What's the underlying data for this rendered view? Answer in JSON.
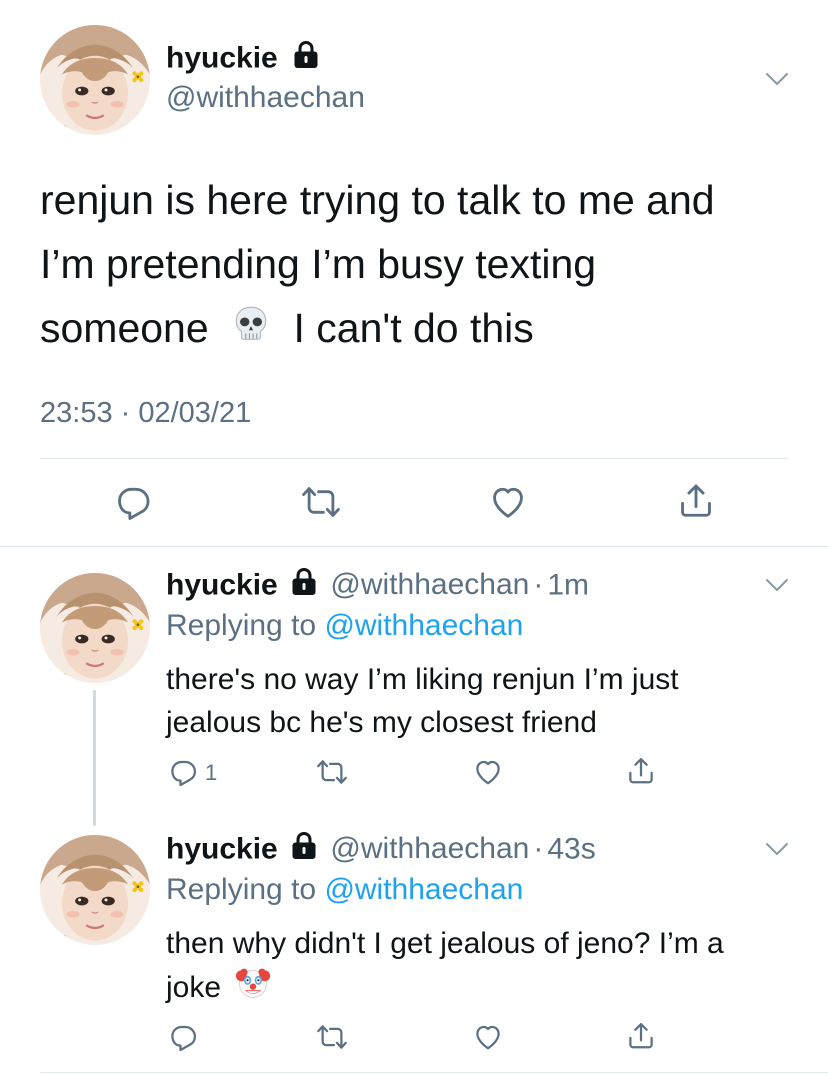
{
  "main_tweet": {
    "display_name": "hyuckie",
    "handle": "@withhaechan",
    "text_line1": "renjun is here trying to talk to me and",
    "text_line2": "I’m pretending I’m busy texting",
    "text_line3a": "someone",
    "text_line3b": "I can't do this",
    "timestamp": "23:53 · 02/03/21",
    "emoji_icon": "skull-icon"
  },
  "replies": [
    {
      "display_name": "hyuckie",
      "handle": "@withhaechan",
      "sep": "·",
      "time": "1m",
      "replying_prefix": "Replying to",
      "replying_handle": "@withhaechan",
      "text_line1": "there's no way I’m liking renjun I’m just",
      "text_line2": "jealous bc he's my closest friend",
      "reply_count": "1"
    },
    {
      "display_name": "hyuckie",
      "handle": "@withhaechan",
      "sep": "·",
      "time": "43s",
      "replying_prefix": "Replying to",
      "replying_handle": "@withhaechan",
      "text_line1": "then why didn't I get jealous of jeno? I’m a",
      "text_line2": "joke",
      "emoji_icon": "clown-face-icon"
    }
  ],
  "colors": {
    "text": "#0f1419",
    "secondary": "#5b7083",
    "link": "#1da1f2",
    "divider": "#e1e8ed"
  }
}
